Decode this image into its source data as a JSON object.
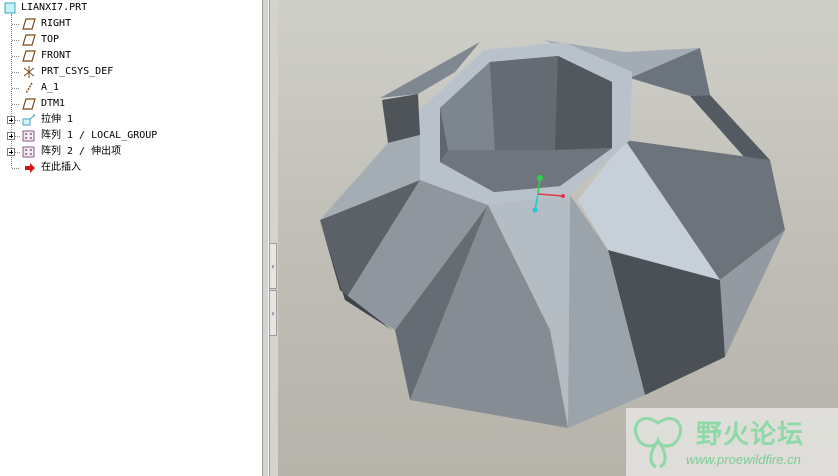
{
  "model_tree": {
    "root": "LIANXI7.PRT",
    "items": [
      {
        "label": "RIGHT",
        "icon": "datum-plane-icon"
      },
      {
        "label": "TOP",
        "icon": "datum-plane-icon"
      },
      {
        "label": "FRONT",
        "icon": "datum-plane-icon"
      },
      {
        "label": "PRT_CSYS_DEF",
        "icon": "csys-icon"
      },
      {
        "label": "A_1",
        "icon": "datum-axis-icon"
      },
      {
        "label": "DTM1",
        "icon": "datum-plane-icon"
      },
      {
        "label": "拉伸 1",
        "icon": "extrude-icon"
      },
      {
        "label": "阵列 1 / LOCAL_GROUP",
        "icon": "pattern-icon"
      },
      {
        "label": "阵列 2 / 伸出项",
        "icon": "pattern-icon"
      },
      {
        "label": "在此插入",
        "icon": "insert-here-arrow-icon"
      }
    ]
  },
  "sash": {
    "collapse_glyph": "‹",
    "expand_glyph": "›"
  },
  "watermark": {
    "title": "野火论坛",
    "url": "www.proewildfire.cn"
  },
  "colors": {
    "viewport_bg": "#c6c4bc",
    "part_face": "#9aa2ab",
    "csys_x": "#e0364a",
    "csys_y": "#2fd14a",
    "csys_z": "#20c8d8",
    "watermark": "#8fd8a8"
  }
}
